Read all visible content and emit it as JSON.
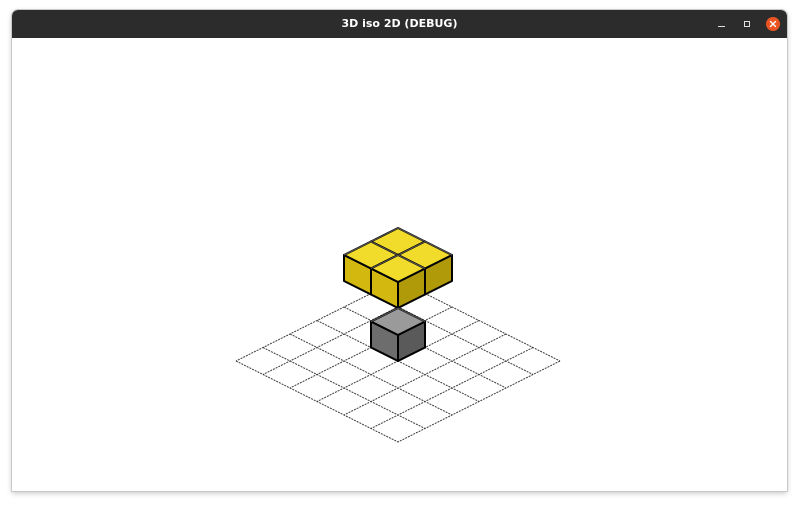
{
  "window": {
    "title": "3D iso 2D (DEBUG)"
  },
  "controls": {
    "minimize_icon": "minimize-icon",
    "maximize_icon": "maximize-icon",
    "close_icon": "close-icon",
    "close_color": "#e95420"
  },
  "scene": {
    "grid": {
      "columns": 6,
      "rows": 6
    },
    "colors": {
      "grid_line": "#3a3a3a",
      "outline": "#000000",
      "yellow_top": "#f1dc2c",
      "yellow_left": "#d2b80f",
      "yellow_right": "#b09a0a",
      "gray_top": "#9a9a9a",
      "gray_left": "#6d6d6d",
      "gray_right": "#5a5a5a"
    },
    "blocks": [
      {
        "name": "yellow-block",
        "color": "yellow",
        "col": 0,
        "row": 0,
        "level": 1
      },
      {
        "name": "yellow-block",
        "color": "yellow",
        "col": 1,
        "row": 0,
        "level": 1
      },
      {
        "name": "yellow-block",
        "color": "yellow",
        "col": 0,
        "row": 1,
        "level": 1
      },
      {
        "name": "yellow-block",
        "color": "yellow",
        "col": 1,
        "row": 1,
        "level": 1
      },
      {
        "name": "gray-block",
        "color": "gray",
        "col": 2,
        "row": 2,
        "level": 0
      }
    ]
  }
}
